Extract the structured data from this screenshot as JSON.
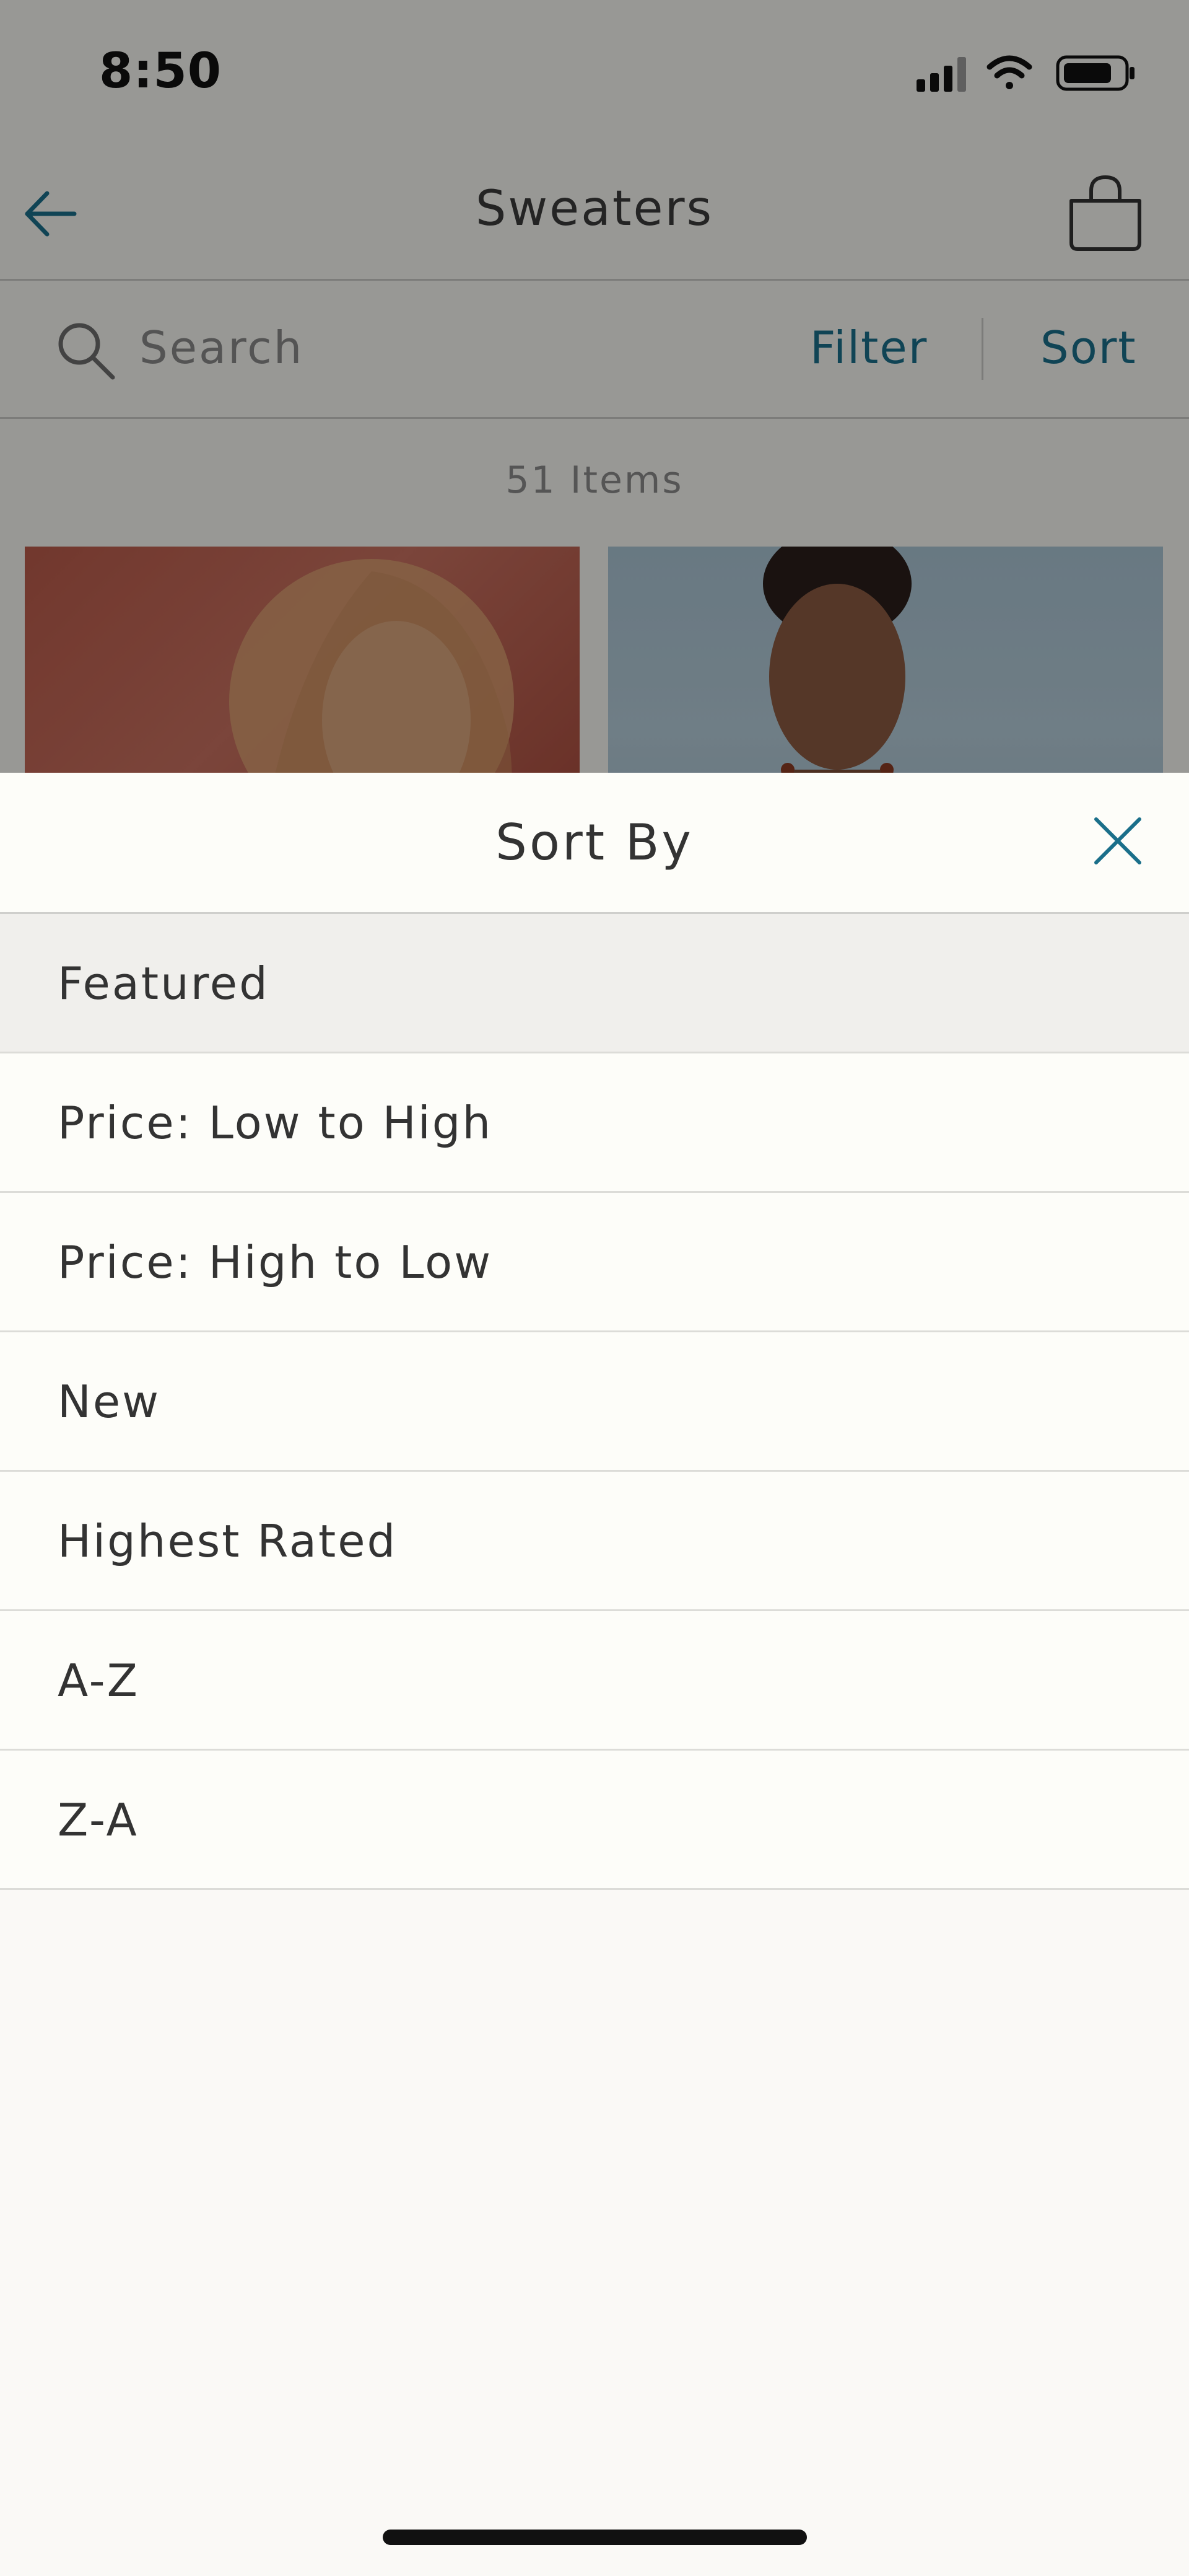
{
  "status_bar": {
    "time": "8:50",
    "icons": [
      "cellular-signal-icon",
      "wifi-icon",
      "battery-icon"
    ]
  },
  "nav": {
    "title": "Sweaters",
    "back_icon": "back-arrow-icon",
    "bag_icon": "shopping-bag-icon"
  },
  "search": {
    "placeholder": "Search",
    "filter_label": "Filter",
    "sort_label": "Sort"
  },
  "listing": {
    "items_count": "51 Items"
  },
  "sort_sheet": {
    "title": "Sort By",
    "close_icon": "close-icon",
    "selected_index": 0,
    "options": [
      {
        "label": "Featured"
      },
      {
        "label": "Price: Low to High"
      },
      {
        "label": "Price: High to Low"
      },
      {
        "label": "New"
      },
      {
        "label": "Highest Rated"
      },
      {
        "label": "A-Z"
      },
      {
        "label": "Z-A"
      }
    ]
  },
  "colors": {
    "accent": "#1a6f8a",
    "selected_row": "#f0efec",
    "sheet_background": "#faf9f6"
  }
}
